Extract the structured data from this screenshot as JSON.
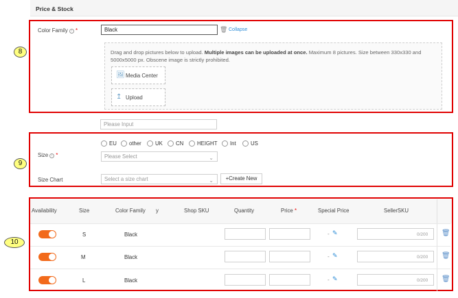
{
  "section": {
    "title": "Price & Stock"
  },
  "badges": [
    "8",
    "9",
    "10"
  ],
  "color_family": {
    "label": "Color Family",
    "info": "i",
    "required": "*",
    "value": "Black",
    "delete_icon": "trash-icon",
    "collapse": "Collapse",
    "drop_text_1": "Drag and drop pictures below to upload. ",
    "drop_text_bold": "Multiple images can be uploaded at once.",
    "drop_text_2": " Maximum 8 pictures. Size between 330x330 and 5000x5000 px. Obscene image is strictly prohibited.",
    "media_center": "Media Center",
    "upload": "Upload"
  },
  "extra_input": {
    "placeholder": "Please Input"
  },
  "size": {
    "label": "Size",
    "info": "i",
    "required": "*",
    "options": [
      "EU",
      "other",
      "UK",
      "CN",
      "HEIGHT",
      "Int",
      "US"
    ],
    "placeholder": "Please Select"
  },
  "size_chart": {
    "label": "Size Chart",
    "placeholder": "Select a size chart",
    "create_new": "+Create New"
  },
  "table": {
    "headers": {
      "availability": "Availability",
      "size": "Size",
      "color_family": "Color Family",
      "clipped": "y",
      "shop_sku": "Shop SKU",
      "quantity": "Quantity",
      "price": "Price",
      "price_req": "*",
      "special_price": "Special Price",
      "seller_sku": "SellerSKU"
    },
    "rows": [
      {
        "size": "S",
        "color": "Black",
        "counter": "0/200",
        "special": "-"
      },
      {
        "size": "M",
        "color": "Black",
        "counter": "0/200",
        "special": "-"
      },
      {
        "size": "L",
        "color": "Black",
        "counter": "0/200",
        "special": "-"
      }
    ]
  },
  "colors": {
    "accent": "#2a8bd6",
    "toggle_on": "#f26a1b",
    "highlight_box": "#e00000",
    "badge": "#ffff80"
  }
}
